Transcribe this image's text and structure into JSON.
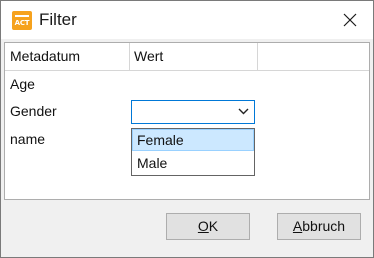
{
  "window": {
    "title": "Filter",
    "app_icon": "visual-act-logo",
    "app_icon_text": "ACT",
    "close_icon": "close-icon"
  },
  "table": {
    "headers": [
      "Metadatum",
      "Wert",
      ""
    ],
    "rows": [
      {
        "metadatum": "Age",
        "wert": ""
      },
      {
        "metadatum": "Gender",
        "wert": ""
      },
      {
        "metadatum": "name",
        "wert": ""
      }
    ]
  },
  "combo": {
    "selected": "",
    "options": [
      "Female",
      "Male"
    ],
    "highlighted": "Female"
  },
  "buttons": {
    "ok_mnemonic": "O",
    "ok_rest": "K",
    "cancel_mnemonic": "A",
    "cancel_rest": "bbruch"
  },
  "colors": {
    "accent": "#0078d7",
    "highlight": "#cce8ff",
    "app_icon": "#f6a21d"
  }
}
